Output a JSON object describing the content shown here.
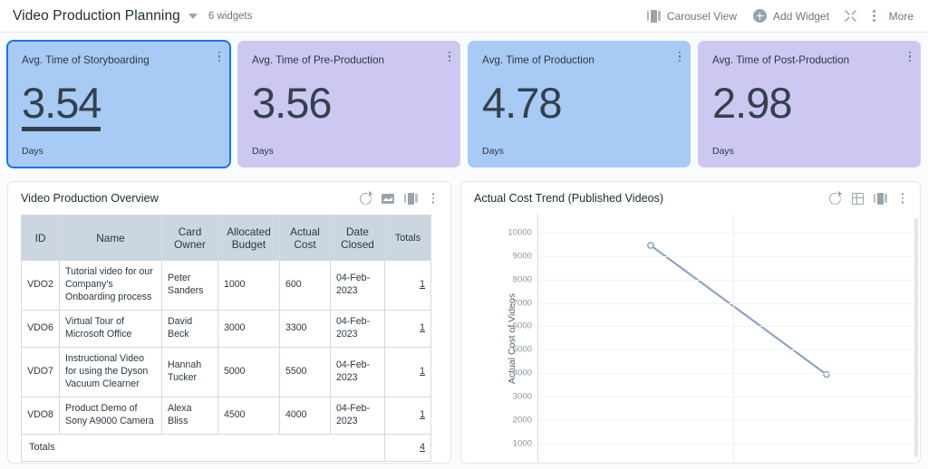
{
  "topbar": {
    "board_title": "Video Production Planning",
    "dropdown_icon": "chevron-down-icon",
    "widget_count": "6 widgets",
    "carousel_view_label": "Carousel View",
    "carousel_icon": "carousel-icon",
    "add_widget_label": "Add Widget",
    "add_widget_icon": "plus-circle-icon",
    "expand_icon": "expand-arrows-icon",
    "more_label": "More",
    "more_icon": "kebab-menu-icon"
  },
  "kpis": [
    {
      "title": "Avg. Time of Storyboarding",
      "value": "3.54",
      "unit": "Days",
      "color": "#a8cbf5",
      "selected": true
    },
    {
      "title": "Avg. Time of Pre-Production",
      "value": "3.56",
      "unit": "Days",
      "color": "#ccc8f2",
      "selected": false
    },
    {
      "title": "Avg. Time of Production",
      "value": "4.78",
      "unit": "Days",
      "color": "#a8cbf5",
      "selected": false
    },
    {
      "title": "Avg. Time of Post-Production",
      "value": "2.98",
      "unit": "Days",
      "color": "#ccc8f2",
      "selected": false
    }
  ],
  "table_widget": {
    "title": "Video Production Overview",
    "actions": [
      "refresh-icon",
      "chart-image-icon",
      "carousel-icon",
      "kebab-menu-icon"
    ],
    "columns": [
      "ID",
      "Name",
      "Card Owner",
      "Allocated Budget",
      "Actual Cost",
      "Date Closed",
      "Totals"
    ],
    "rows": [
      {
        "id": "VDO2",
        "name": "Tutorial video for our Company's Onboarding process",
        "owner": "Peter Sanders",
        "allocated": "1000",
        "actual": "600",
        "closed": "04-Feb-2023",
        "total": "1"
      },
      {
        "id": "VDO6",
        "name": "Virtual Tour of Microsoft Office",
        "owner": "David Beck",
        "allocated": "3000",
        "actual": "3300",
        "closed": "04-Feb-2023",
        "total": "1"
      },
      {
        "id": "VDO7",
        "name": "Instructional Video for using the Dyson Vacuum Clearner",
        "owner": "Hannah Tucker",
        "allocated": "5000",
        "actual": "5500",
        "closed": "04-Feb-2023",
        "total": "1"
      },
      {
        "id": "VDO8",
        "name": "Product Demo of Sony A9000 Camera",
        "owner": "Alexa Bliss",
        "allocated": "4500",
        "actual": "4000",
        "closed": "04-Feb-2023",
        "total": "1"
      }
    ],
    "totals_label": "Totals",
    "totals_value": "4"
  },
  "chart_widget": {
    "title": "Actual Cost Trend (Published Videos)",
    "actions": [
      "refresh-icon",
      "grid-table-icon",
      "carousel-icon",
      "kebab-menu-icon"
    ]
  },
  "chart_data": {
    "type": "line",
    "title": "Actual Cost Trend (Published Videos)",
    "xlabel": "",
    "ylabel": "Actual Cost of Videos",
    "ylim": [
      500,
      10300
    ],
    "yticks": [
      10000,
      9000,
      8000,
      7000,
      6000,
      5000,
      4000,
      3000,
      2000,
      1000
    ],
    "grid": true,
    "legend": "none",
    "series": [
      {
        "name": "Actual Cost of Videos",
        "color": "#8fa3c4",
        "marker": "open-circle",
        "points": [
          {
            "x": 0.3,
            "y": 9450
          },
          {
            "x": 0.77,
            "y": 3950
          }
        ]
      }
    ]
  }
}
